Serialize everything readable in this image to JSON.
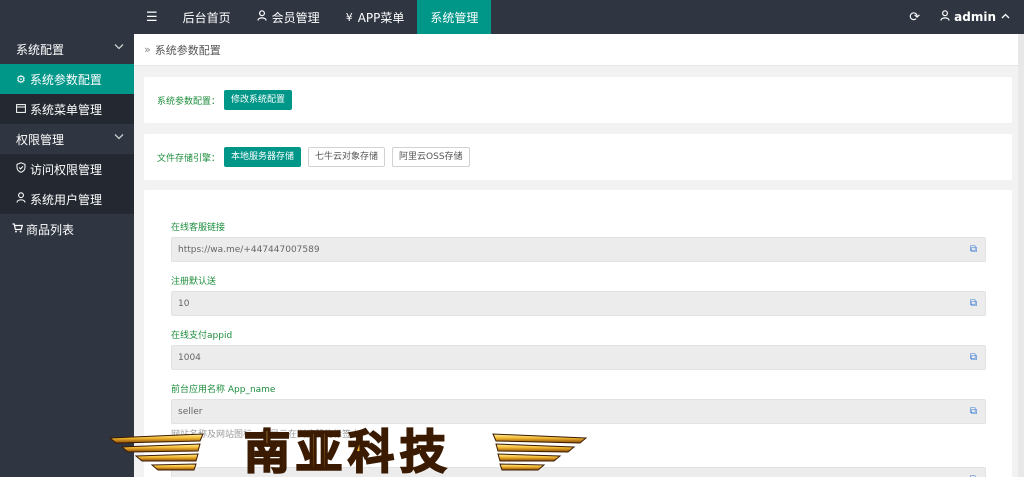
{
  "topbar": {
    "menu_icon": "hamburger-icon",
    "nav": [
      {
        "label": "后台首页",
        "icon": ""
      },
      {
        "label": "会员管理",
        "icon": "user-icon"
      },
      {
        "label": "APP菜单",
        "icon": "yen-icon"
      },
      {
        "label": "系统管理",
        "icon": "",
        "active": true
      }
    ],
    "refresh_icon": "refresh-icon",
    "user_label": "admin"
  },
  "sidebar": {
    "groups": [
      {
        "label": "系统配置",
        "items": [
          {
            "label": "系统参数配置",
            "icon": "gear-icon",
            "active": true
          },
          {
            "label": "系统菜单管理",
            "icon": "window-icon"
          }
        ]
      },
      {
        "label": "权限管理",
        "items": [
          {
            "label": "访问权限管理",
            "icon": "shield-icon"
          },
          {
            "label": "系统用户管理",
            "icon": "user-icon"
          }
        ]
      }
    ],
    "extra": {
      "label": "商品列表",
      "icon": "cart-icon"
    }
  },
  "breadcrumb": "系统参数配置",
  "params_card": {
    "label": "系统参数配置：",
    "button": "修改系统配置"
  },
  "storage_card": {
    "label": "文件存储引擎：",
    "options": [
      "本地服务器存储",
      "七牛云对象存储",
      "阿里云OSS存储"
    ],
    "selected": 0
  },
  "fields": [
    {
      "label": "在线客服链接",
      "value": "https://wa.me/+447447007589"
    },
    {
      "label": "注册默认送",
      "value": "10"
    },
    {
      "label": "在线支付appid",
      "value": "1004"
    },
    {
      "label": "前台应用名称 App_name",
      "value": "seller",
      "help": "网站名称及网站图标，将显示在浏览器的标签上"
    }
  ],
  "colors": {
    "accent": "#009688",
    "sidebar": "#2f3541",
    "sidebar_dark": "#232831",
    "label_green": "#1e8e3e"
  },
  "watermark": "南亚科技"
}
